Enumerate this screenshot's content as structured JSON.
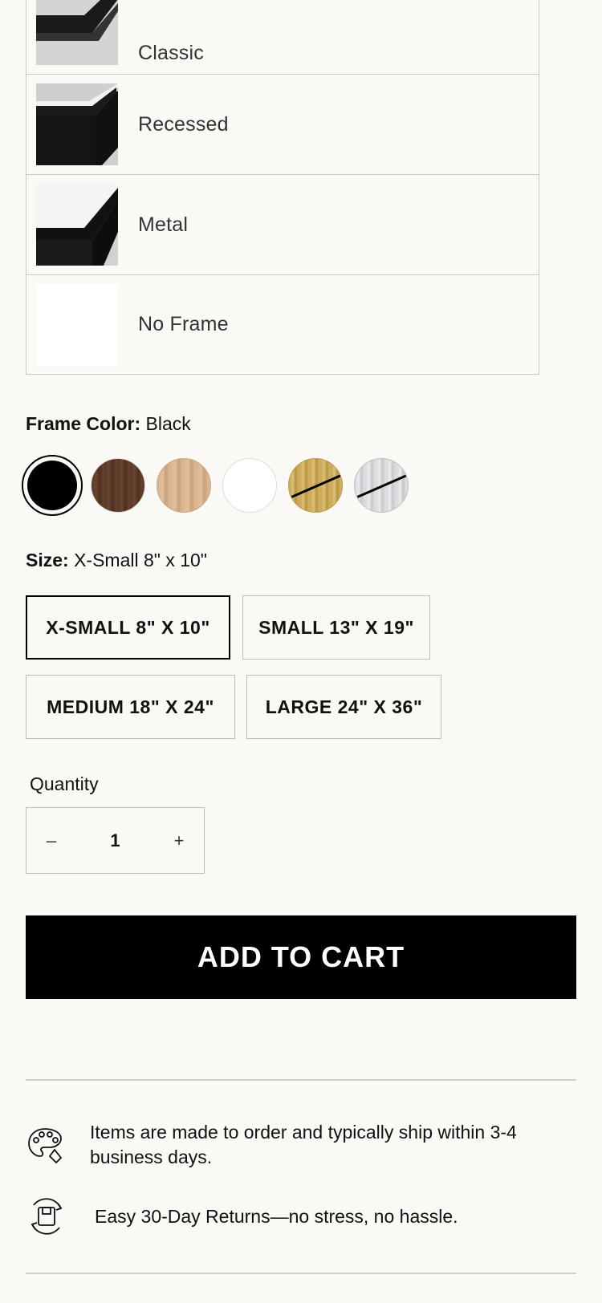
{
  "frame_styles": [
    {
      "label": "Classic",
      "thumb": "black-frame-corner"
    },
    {
      "label": "Recessed",
      "thumb": "black-frame-corner"
    },
    {
      "label": "Metal",
      "thumb": "black-frame-corner"
    },
    {
      "label": "No Frame",
      "thumb": "blank"
    }
  ],
  "frame_color": {
    "label": "Frame Color:",
    "value": "Black",
    "swatches": [
      {
        "name": "Black",
        "color": "#000000",
        "selected": true
      },
      {
        "name": "Walnut",
        "color": "#5b3a29"
      },
      {
        "name": "Natural",
        "color": "#d8b48e"
      },
      {
        "name": "White",
        "color": "#ffffff"
      },
      {
        "name": "Gold",
        "color": "#c9a957",
        "unavailable": true
      },
      {
        "name": "Silver",
        "color": "#d6d6d9",
        "unavailable": true
      }
    ]
  },
  "size": {
    "label": "Size:",
    "value": "X-Small 8\" x 10\"",
    "options": [
      {
        "label": "X-SMALL 8\" X 10\"",
        "selected": true
      },
      {
        "label": "SMALL 13\" X 19\""
      },
      {
        "label": "MEDIUM 18\" X 24\""
      },
      {
        "label": "LARGE 24\" X 36\""
      }
    ]
  },
  "quantity": {
    "label": "Quantity",
    "value": "1",
    "decrement": "–",
    "increment": "+"
  },
  "cart": {
    "button_label": "ADD TO CART"
  },
  "info": [
    {
      "icon": "palette-icon",
      "text": "Items are made to order and typically ship within 3-4 business days."
    },
    {
      "icon": "return-box-icon",
      "text": "Easy 30-Day Returns—no stress, no hassle."
    }
  ]
}
